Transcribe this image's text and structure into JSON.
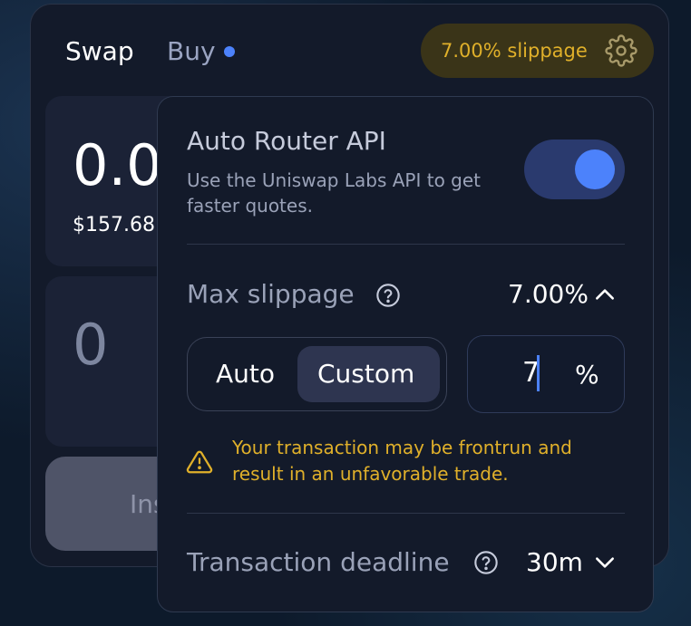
{
  "header": {
    "tabs": [
      {
        "label": "Swap",
        "active": true
      },
      {
        "label": "Buy",
        "has_indicator": true
      }
    ],
    "slippage_button": {
      "label": "7.00% slippage",
      "icon": "gear-icon"
    }
  },
  "swap": {
    "sell_amount": "0.0",
    "sell_usd": "$157.68",
    "buy_amount": "0",
    "action_label": "Ins"
  },
  "settings": {
    "auto_router": {
      "title": "Auto Router API",
      "description": "Use the Uniswap Labs API to get faster quotes.",
      "enabled": true
    },
    "max_slippage": {
      "label": "Max slippage",
      "value": "7.00%",
      "modes": [
        "Auto",
        "Custom"
      ],
      "selected_mode": "Custom",
      "input_value": "7",
      "unit": "%",
      "warning": "Your transaction may be frontrun and result in an unfavorable trade."
    },
    "deadline": {
      "label": "Transaction deadline",
      "value": "30m"
    }
  },
  "colors": {
    "accent": "#4c82fb",
    "warning": "#e0b02a",
    "panel": "#131a2a"
  }
}
